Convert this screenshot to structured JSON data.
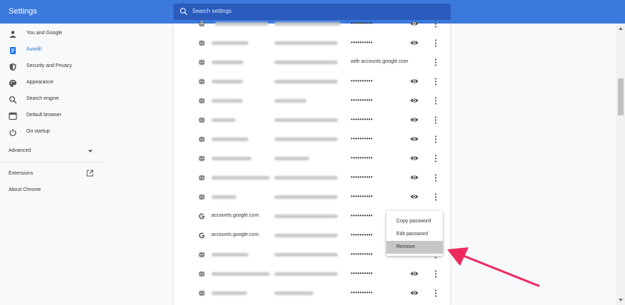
{
  "header": {
    "title": "Settings",
    "search_placeholder": "Search settings"
  },
  "sidebar": {
    "items": [
      {
        "label": "You and Google",
        "icon": "person-icon"
      },
      {
        "label": "Autofill",
        "icon": "autofill-clipboard-icon",
        "active": true
      },
      {
        "label": "Security and Privacy",
        "icon": "shield-icon"
      },
      {
        "label": "Appearance",
        "icon": "palette-icon"
      },
      {
        "label": "Search engine",
        "icon": "search-icon"
      },
      {
        "label": "Default browser",
        "icon": "browser-window-icon"
      },
      {
        "label": "On startup",
        "icon": "power-icon"
      }
    ],
    "advanced_label": "Advanced",
    "extensions_label": "Extensions",
    "about_label": "About Chrome"
  },
  "passwords": {
    "mask": "••••••••••",
    "google_site": "accounts.google.com",
    "federated_note": "with accounts.google.com"
  },
  "menu": {
    "copy": "Copy password",
    "edit": "Edit password",
    "remove": "Remove"
  },
  "colors": {
    "header": "#3c79dd",
    "accent": "#1a73e8",
    "arrow": "#ee2a5d"
  }
}
